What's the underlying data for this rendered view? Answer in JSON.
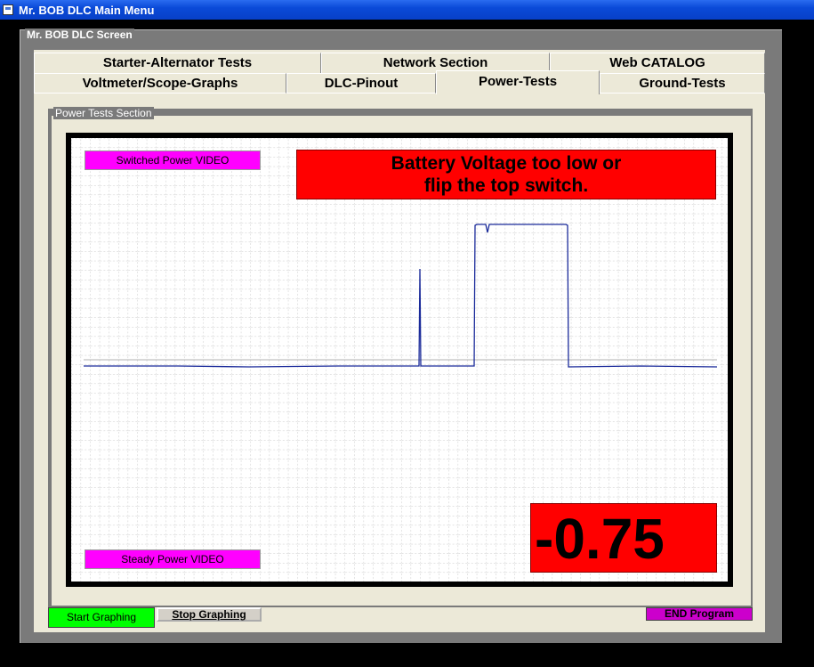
{
  "window": {
    "title": "Mr. BOB DLC Main Menu",
    "icon": "app-window-icon"
  },
  "frame": {
    "label": "Mr. BOB DLC Screen"
  },
  "tabs": {
    "row1": [
      {
        "label": "Starter-Alternator Tests"
      },
      {
        "label": "Network Section"
      },
      {
        "label": "Web CATALOG"
      }
    ],
    "row2": [
      {
        "label": "Voltmeter/Scope-Graphs"
      },
      {
        "label": "DLC-Pinout"
      },
      {
        "label": "Power-Tests",
        "active": true
      },
      {
        "label": "Ground-Tests"
      }
    ]
  },
  "section": {
    "label": "Power Tests Section"
  },
  "scope": {
    "switched_video_label": "Switched Power VIDEO",
    "steady_video_label": "Steady Power VIDEO",
    "warning_line1": "Battery Voltage too low or",
    "warning_line2": "flip the top switch.",
    "reading": "-0.75"
  },
  "buttons": {
    "start": "Start Graphing",
    "stop": "Stop Graphing",
    "end": "END Program"
  },
  "colors": {
    "titlebar": "#0a4ad8",
    "trace": "#1a2a9a",
    "warning_bg": "#ff0000",
    "video_button": "#ff00ff",
    "start_button": "#00ff00",
    "end_button": "#cc00cc"
  }
}
